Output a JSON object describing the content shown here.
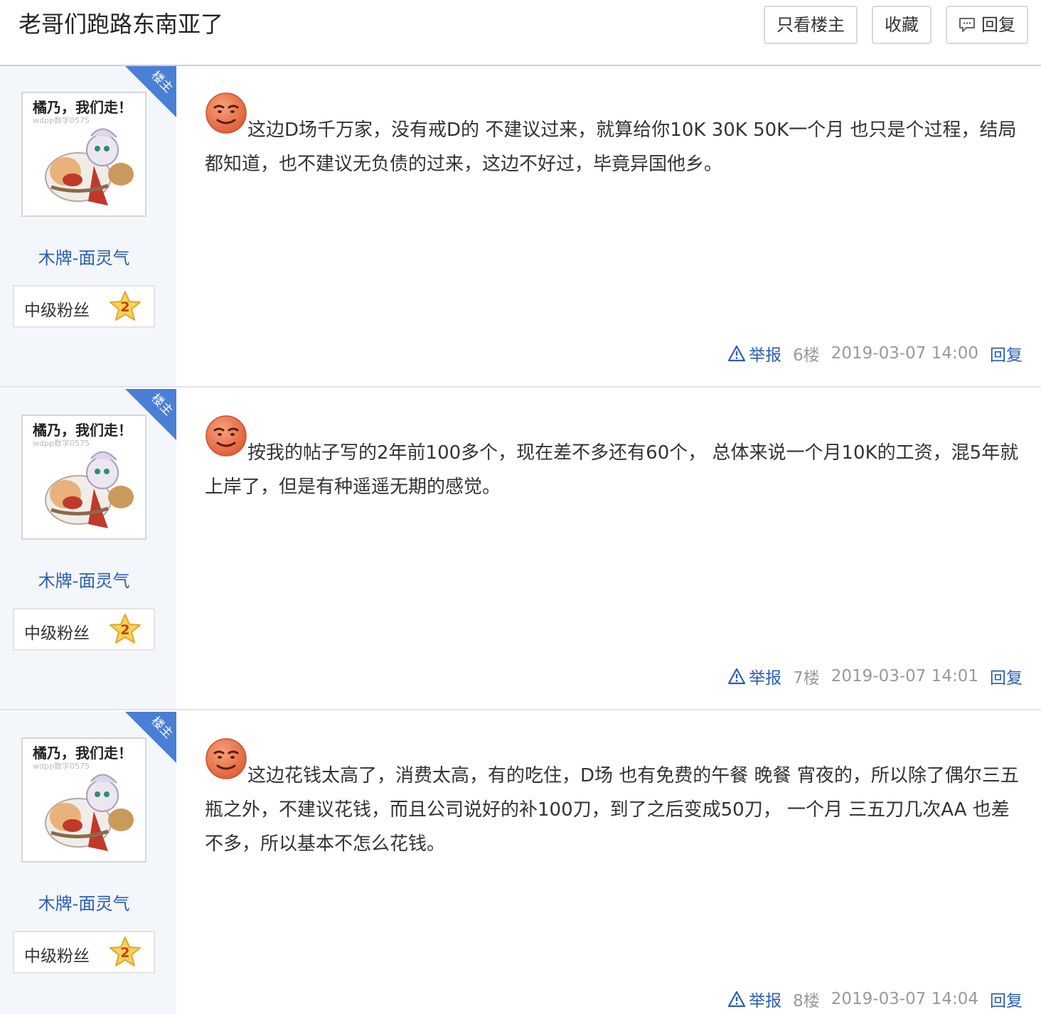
{
  "header": {
    "title": "老哥们跑路东南亚了",
    "only_op_label": "只看楼主",
    "favorite_label": "收藏",
    "reply_label": "回复"
  },
  "posts": [
    {
      "ribbon_label": "楼主",
      "avatar_text": "橘乃，我们走！",
      "avatar_watermark": "wdpp数字0575",
      "username": "木牌-面灵气",
      "rank_label": "中级粉丝",
      "rank_level": "2",
      "content": "这边D场千万家，没有戒D的 不建议过来，就算给你10K 30K 50K一个月 也只是个过程，结局都知道，也不建议无负债的过来，这边不好过，毕竟异国他乡。",
      "report_label": "举报",
      "floor": "6楼",
      "time": "2019-03-07 14:00",
      "reply_label": "回复"
    },
    {
      "ribbon_label": "楼主",
      "avatar_text": "橘乃，我们走！",
      "avatar_watermark": "wdpp数字0575",
      "username": "木牌-面灵气",
      "rank_label": "中级粉丝",
      "rank_level": "2",
      "content": "按我的帖子写的2年前100多个，现在差不多还有60个， 总体来说一个月10K的工资，混5年就上岸了，但是有种遥遥无期的感觉。",
      "report_label": "举报",
      "floor": "7楼",
      "time": "2019-03-07 14:01",
      "reply_label": "回复"
    },
    {
      "ribbon_label": "楼主",
      "avatar_text": "橘乃，我们走！",
      "avatar_watermark": "wdpp数字0575",
      "username": "木牌-面灵气",
      "rank_label": "中级粉丝",
      "rank_level": "2",
      "content": "这边花钱太高了，消费太高，有的吃住，D场 也有免费的午餐 晚餐 宵夜的，所以除了偶尔三五瓶之外，不建议花钱，而且公司说好的补100刀，到了之后变成50刀， 一个月 三五刀几次AA 也差不多，所以基本不怎么花钱。",
      "report_label": "举报",
      "floor": "8楼",
      "time": "2019-03-07 14:04",
      "reply_label": "回复"
    }
  ],
  "colors": {
    "link": "#2b5eb0",
    "ribbon": "#4a7fd6",
    "sidebar": "#f3f6fa"
  }
}
